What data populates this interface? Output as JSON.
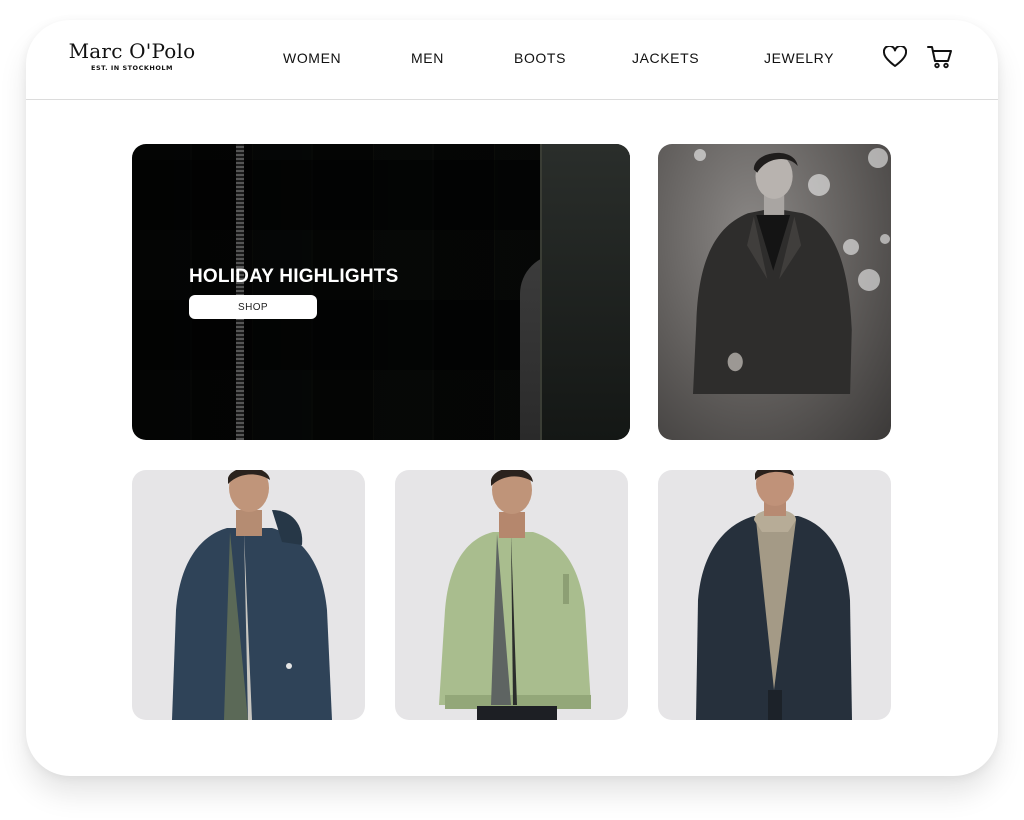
{
  "header": {
    "brand_name": "Marc O'Polo",
    "brand_tagline": "EST. IN STOCKHOLM",
    "nav": [
      "WOMEN",
      "MEN",
      "BOOTS",
      "JACKETS",
      "JEWELRY"
    ],
    "icons": [
      "heart-icon",
      "cart-icon"
    ]
  },
  "hero": {
    "title": "HOLIDAY HIGHLIGHTS",
    "button_label": "SHOP"
  },
  "colors": {
    "text": "#111111",
    "background": "#ffffff",
    "jacket_navy": "#2f4358",
    "jacket_sage": "#a9bd8e",
    "jacket_dark": "#26303c"
  }
}
